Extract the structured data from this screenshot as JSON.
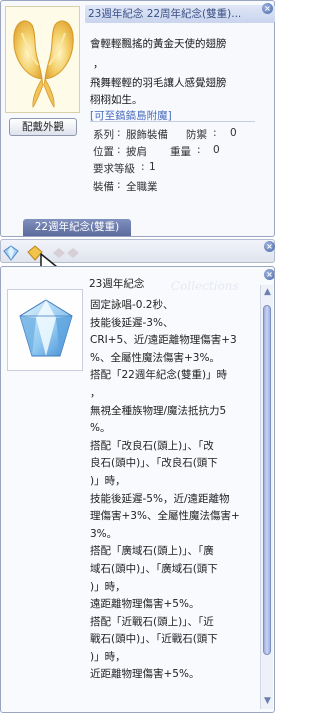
{
  "item_window": {
    "title": "23週年紀念 22周年紀念(雙重)...",
    "description": [
      "會輕輕飄搖的黃金天使的翅膀",
      "，",
      "飛舞輕輕的羽毛讓人感覺翅膀",
      "栩栩如生。"
    ],
    "reform_link": "[可至鎬鎬島附魔]",
    "wear_button": "配戴外觀",
    "tab_label": "22週年紀念(雙重)",
    "stats": {
      "type_label": "系列",
      "type_value": "服飾裝備",
      "defense_label": "防禦",
      "defense_value": "0",
      "position_label": "位置",
      "position_value": "披肩",
      "weight_label": "重量",
      "weight_value": "0",
      "level_label": "要求等級",
      "level_value": "1",
      "job_label": "裝備",
      "job_value": "全職業"
    }
  },
  "card_window": {
    "title": "23週年紀念",
    "watermark": "Collections",
    "lines": [
      "固定詠唱-0.2秒、",
      "技能後延遲-3%、",
      "CRI+5、近/遠距離物理傷害+3",
      "%、全屬性魔法傷害+3%。",
      "搭配「22週年紀念(雙重)」時",
      "，",
      "無視全種族物理/魔法抵抗力5",
      "%。",
      "搭配「改良石(頭上)」、「改",
      "良石(頭中)」、「改良石(頭下",
      ")」時，",
      "技能後延遲-5%，近/遠距離物",
      "理傷害+3%、全屬性魔法傷害+",
      "3%。",
      "搭配「廣域石(頭上)」、「廣",
      "域石(頭中)」、「廣域石(頭下",
      ")」時，",
      "遠距離物理傷害+5%。",
      "搭配「近戰石(頭上)」、「近",
      "戰石(頭中)」、「近戰石(頭下",
      ")」時，",
      "近距離物理傷害+5%。"
    ]
  },
  "icons": {
    "close": "×",
    "scroll_up": "▲",
    "scroll_down": "▼"
  },
  "colors": {
    "header_bg": "#c9d5ee",
    "tab_bg": "#6676a8",
    "link": "#4a6bc0",
    "scroll_thumb": "#9eb0dd"
  }
}
